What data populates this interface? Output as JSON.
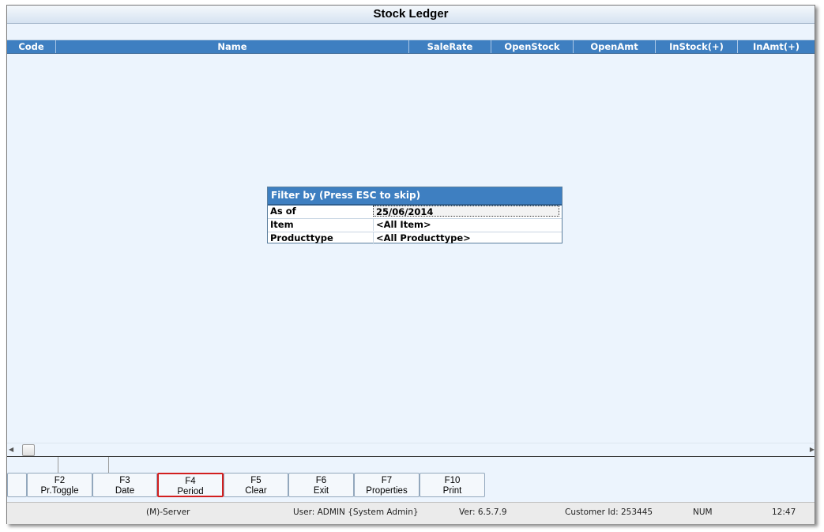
{
  "window": {
    "title": "Stock Ledger"
  },
  "grid": {
    "columns": [
      "Code",
      "Name",
      "SaleRate",
      "OpenStock",
      "OpenAmt",
      "InStock(+)",
      "InAmt(+)"
    ]
  },
  "filter": {
    "title": "Filter by (Press ESC to skip)",
    "rows": [
      {
        "label": "As of",
        "value": "25/06/2014"
      },
      {
        "label": "Item",
        "value": "<All Item>"
      },
      {
        "label": "Producttype",
        "value": "<All Producttype>"
      }
    ]
  },
  "function_keys": [
    {
      "key": "F2",
      "label": "Pr.Toggle"
    },
    {
      "key": "F3",
      "label": "Date"
    },
    {
      "key": "F4",
      "label": "Period"
    },
    {
      "key": "F5",
      "label": "Clear"
    },
    {
      "key": "F6",
      "label": "Exit"
    },
    {
      "key": "F7",
      "label": "Properties"
    },
    {
      "key": "F10",
      "label": "Print"
    }
  ],
  "status": {
    "server": "(M)-Server",
    "user": "User: ADMIN {System Admin}",
    "version": "Ver: 6.5.7.9",
    "customer": "Customer Id: 253445",
    "numlock": "NUM",
    "time": "12:47"
  },
  "colors": {
    "header_blue": "#3e7fc1",
    "panel_bg": "#ecf4fd",
    "highlight_red": "#d21f1f"
  }
}
